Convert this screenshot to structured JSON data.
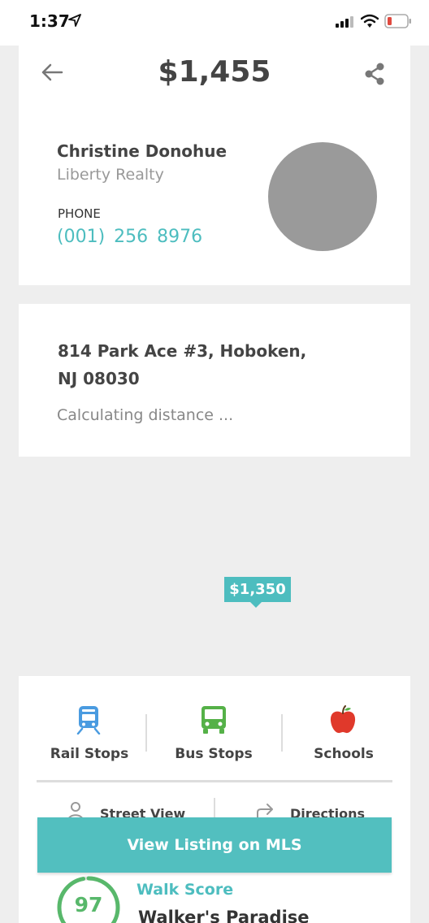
{
  "status_bar": {
    "time": "1:37",
    "battery_color": "#e04a3f"
  },
  "header": {
    "price": "$1,455",
    "back_icon": "arrow-left-icon",
    "share_icon": "share-icon"
  },
  "agent": {
    "name": "Christine Donohue",
    "company": "Liberty Realty",
    "phone_label": "PHONE",
    "phone": "(001) 256 8976"
  },
  "address": {
    "line1": "814 Park Ace  #3, Hoboken,",
    "line2": "NJ 08030",
    "distance": "Calculating distance ..."
  },
  "map": {
    "pin_price": "$1,350"
  },
  "amenities": [
    {
      "label": "Rail Stops",
      "icon": "train-icon",
      "color": "#4a9be0"
    },
    {
      "label": "Bus Stops",
      "icon": "bus-icon",
      "color": "#55b148"
    },
    {
      "label": "Schools",
      "icon": "apple-icon",
      "color": "#e0392b"
    }
  ],
  "actions": {
    "street_view": "Street View",
    "directions": "Directions"
  },
  "mls_button": "View Listing on MLS",
  "walk_score": {
    "label": "Walk Score",
    "value": "97",
    "description": "Walker's Paradise"
  },
  "colors": {
    "accent": "#4dbdbf",
    "score_ring": "#58b86b"
  }
}
